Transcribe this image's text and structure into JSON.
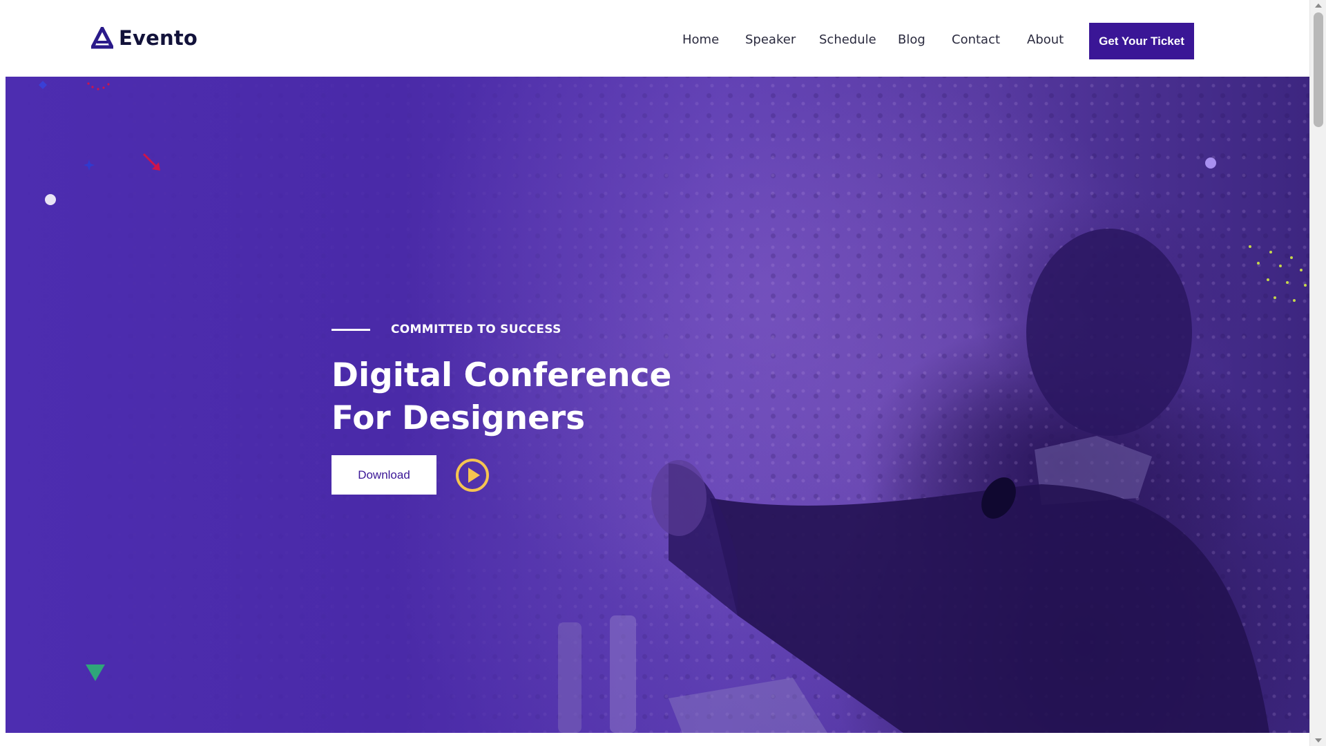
{
  "brand": {
    "name": "Evento",
    "logo_icon": "triangle-a-logo-icon"
  },
  "nav": {
    "items": [
      {
        "label": "Home"
      },
      {
        "label": "Speaker"
      },
      {
        "label": "Schedule"
      },
      {
        "label": "Blog"
      },
      {
        "label": "Contact"
      },
      {
        "label": "About"
      }
    ],
    "cta_label": "Get Your Ticket"
  },
  "hero": {
    "eyebrow": "COMMITTED TO SUCCESS",
    "title_line1": "Digital Conference",
    "title_line2": "For Designers",
    "download_label": "Download",
    "play_icon": "play-circle-icon"
  },
  "colors": {
    "brand_purple": "#3a1696",
    "hero_overlay": "#4a2aa6",
    "play_accent": "#f5c451",
    "dot_white": "#e9e4f5",
    "dot_lavender": "#a990f0",
    "triangle_green": "#2fa57a",
    "arrow_red": "#d0134a",
    "dots_yellowgreen": "#c6d84a"
  },
  "page_progress": 0.17
}
